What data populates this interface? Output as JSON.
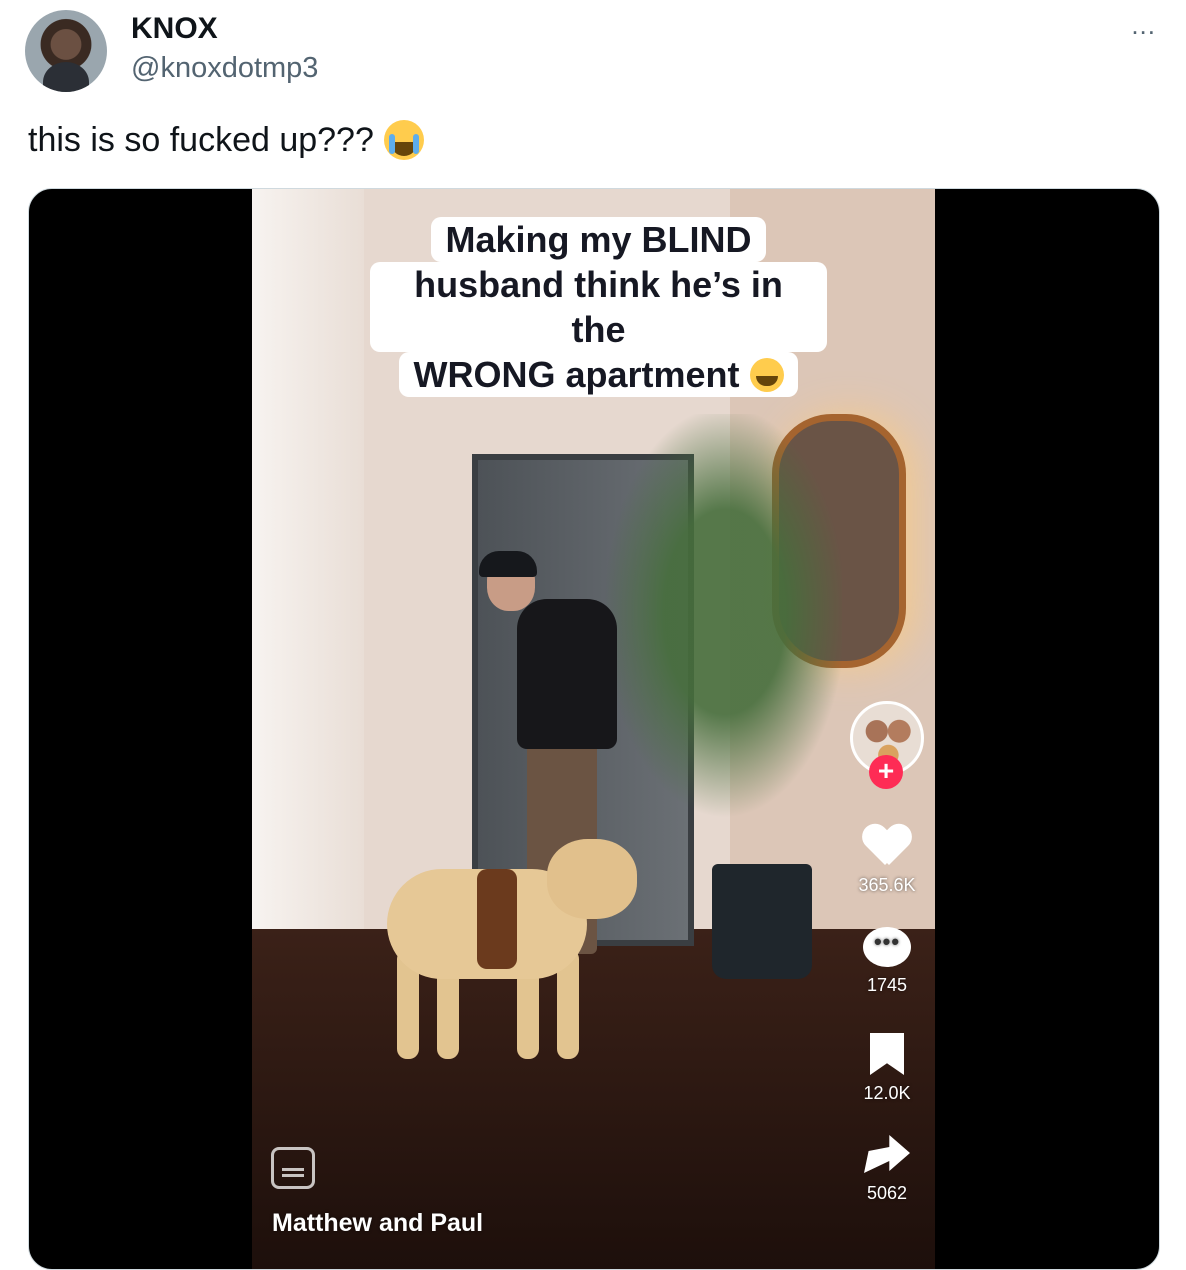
{
  "post": {
    "display_name": "KNOX",
    "handle": "@knoxdotmp3",
    "more_icon": "...",
    "text": "this is so fucked up???",
    "text_emoji": "loudly-crying-face-emoji"
  },
  "video": {
    "caption_lines": [
      "Making my BLIND",
      "husband think he’s in the",
      "WRONG apartment"
    ],
    "caption_emoji": "tears-of-joy-emoji",
    "author": "Matthew and Paul",
    "follow_symbol": "+",
    "likes": "365.6K",
    "comments": "1745",
    "comments_icon_text": "•••",
    "bookmarks": "12.0K",
    "shares": "5062"
  }
}
